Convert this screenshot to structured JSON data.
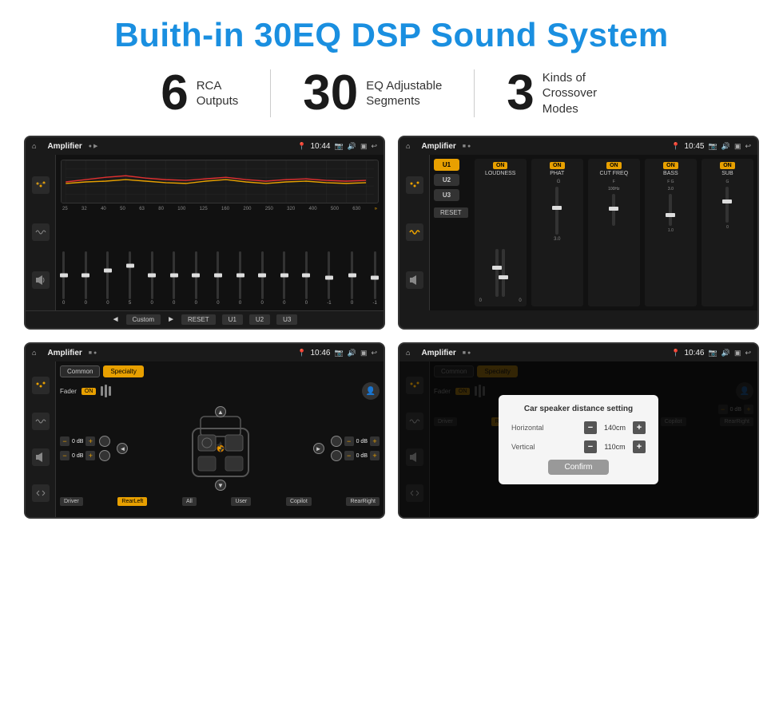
{
  "title": "Buith-in 30EQ DSP Sound System",
  "stats": [
    {
      "number": "6",
      "label": "RCA\nOutputs"
    },
    {
      "number": "30",
      "label": "EQ Adjustable\nSegments"
    },
    {
      "number": "3",
      "label": "Kinds of\nCrossover Modes"
    }
  ],
  "screens": {
    "screen1": {
      "topbar": {
        "title": "Amplifier",
        "time": "10:44"
      },
      "eq_freqs": [
        "25",
        "32",
        "40",
        "50",
        "63",
        "80",
        "100",
        "125",
        "160",
        "200",
        "250",
        "320",
        "400",
        "500",
        "630"
      ],
      "eq_values": [
        "0",
        "0",
        "0",
        "5",
        "0",
        "0",
        "0",
        "0",
        "0",
        "0",
        "0",
        "0",
        "-1",
        "0",
        "-1"
      ],
      "buttons": [
        "◄",
        "Custom",
        "►",
        "RESET",
        "U1",
        "U2",
        "U3"
      ]
    },
    "screen2": {
      "topbar": {
        "title": "Amplifier",
        "time": "10:45"
      },
      "presets": [
        "U1",
        "U2",
        "U3"
      ],
      "bands": [
        {
          "name": "LOUDNESS",
          "on": true
        },
        {
          "name": "PHAT",
          "on": true
        },
        {
          "name": "CUT FREQ",
          "on": true
        },
        {
          "name": "BASS",
          "on": true
        },
        {
          "name": "SUB",
          "on": true
        }
      ],
      "reset_label": "RESET"
    },
    "screen3": {
      "topbar": {
        "title": "Amplifier",
        "time": "10:46"
      },
      "tabs": [
        "Common",
        "Specialty"
      ],
      "fader_label": "Fader",
      "fader_on": "ON",
      "volumes": {
        "tl": "0 dB",
        "bl": "0 dB",
        "tr": "0 dB",
        "br": "0 dB"
      },
      "positions": [
        "Driver",
        "RearLeft",
        "All",
        "User",
        "Copilot",
        "RearRight"
      ]
    },
    "screen4": {
      "topbar": {
        "title": "Amplifier",
        "time": "10:46"
      },
      "tabs": [
        "Common",
        "Specialty"
      ],
      "dialog": {
        "title": "Car speaker distance setting",
        "horizontal_label": "Horizontal",
        "horizontal_value": "140cm",
        "vertical_label": "Vertical",
        "vertical_value": "110cm",
        "confirm_label": "Confirm"
      },
      "bottom_labels": {
        "right_vol1": "0 dB",
        "right_vol2": "0 dB",
        "driver": "Driver",
        "rearleft": "RearLef...",
        "all": "All",
        "user": "User",
        "copilot": "Copilot",
        "rearright": "RearRight"
      }
    }
  }
}
